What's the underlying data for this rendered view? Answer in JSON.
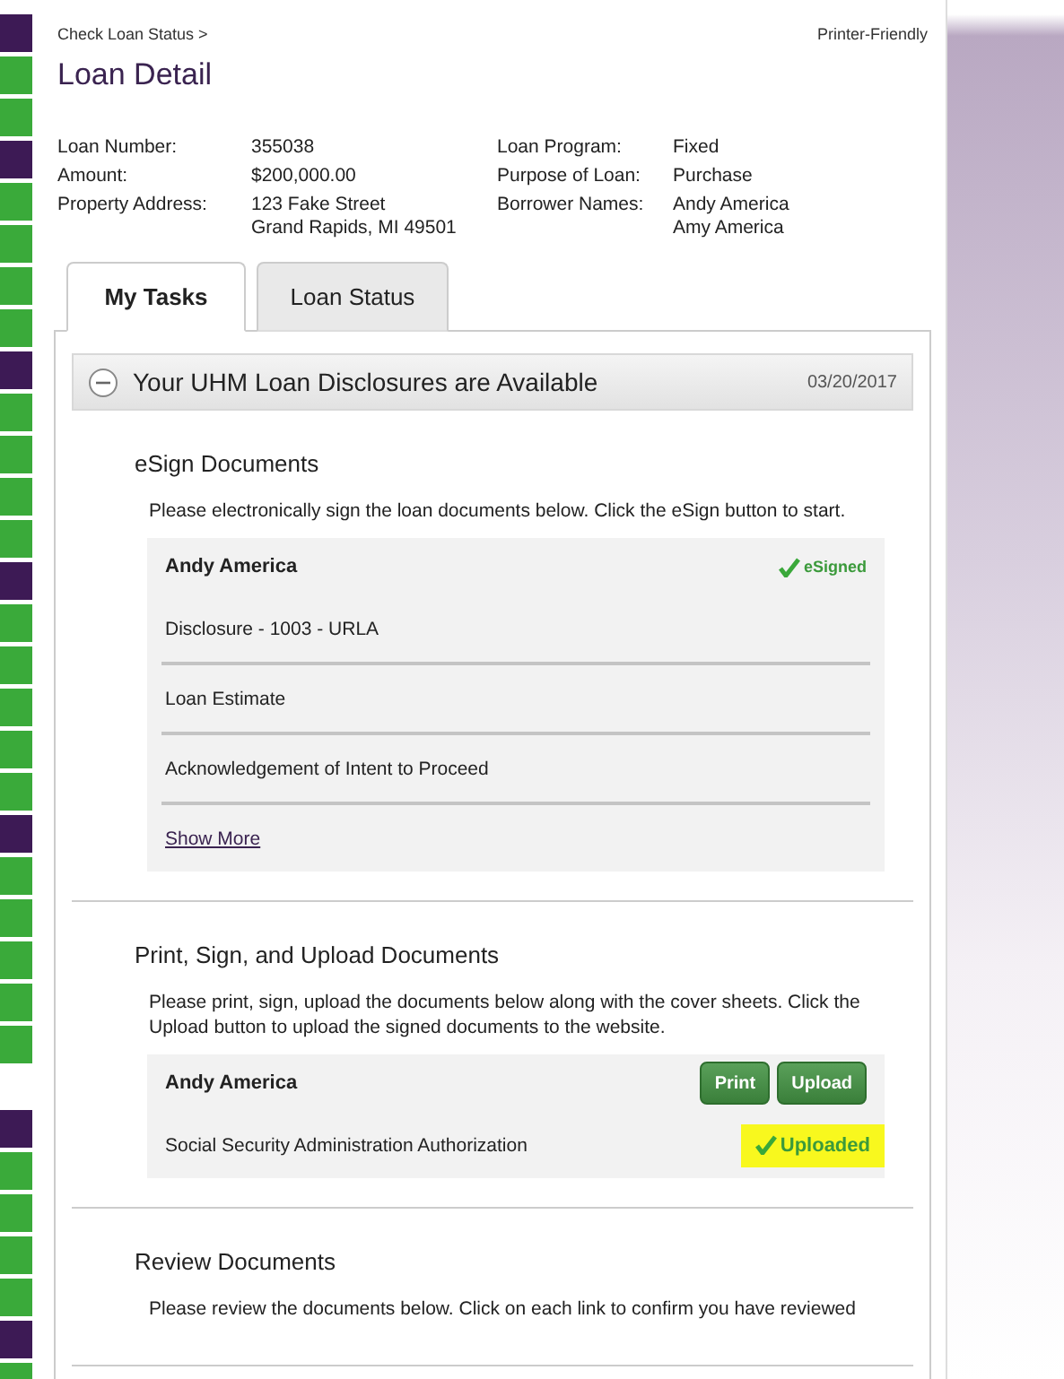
{
  "breadcrumb": "Check Loan Status >",
  "printer_link": "Printer-Friendly",
  "title": "Loan Detail",
  "details": [
    [
      {
        "label": "Loan Number:",
        "value": [
          "355038"
        ]
      },
      {
        "label": "Loan Program:",
        "value": [
          "Fixed"
        ]
      }
    ],
    [
      {
        "label": "Amount:",
        "value": [
          "$200,000.00"
        ]
      },
      {
        "label": "Purpose of Loan:",
        "value": [
          "Purchase"
        ]
      }
    ],
    [
      {
        "label": "Property Address:",
        "value": [
          "123 Fake Street",
          "Grand Rapids, MI 49501"
        ]
      },
      {
        "label": "Borrower Names:",
        "value": [
          "Andy America",
          "Amy America"
        ]
      }
    ]
  ],
  "tabs": [
    {
      "label": "My Tasks",
      "selected": true
    },
    {
      "label": "Loan Status",
      "selected": false
    }
  ],
  "panel": {
    "title": "Your UHM Loan Disclosures are Available",
    "date": "03/20/2017",
    "expanded": true
  },
  "sections": [
    {
      "heading": "eSign Documents",
      "description": "Please electronically sign the loan documents below. Click the eSign button to start.",
      "borrower": "Andy America",
      "status": {
        "kind": "esigned",
        "label": "eSigned",
        "highlighted": false
      },
      "documents": [
        "Disclosure - 1003 - URLA",
        "Loan Estimate",
        "Acknowledgement of Intent to Proceed"
      ],
      "more_link": "Show More"
    },
    {
      "heading": "Print, Sign, and Upload Documents",
      "description": "Please print, sign, upload the documents below along with the cover sheets. Click the Upload button to upload the signed documents to the website.",
      "borrower": "Andy America",
      "actions": [
        "Print",
        "Upload"
      ],
      "documents": [
        "Social Security Administration Authorization"
      ],
      "doc_status": {
        "kind": "uploaded",
        "label": "Uploaded",
        "highlighted": true
      }
    },
    {
      "heading": "Review Documents",
      "description": "Please review the documents below. Click on each link to confirm you have reviewed"
    }
  ]
}
